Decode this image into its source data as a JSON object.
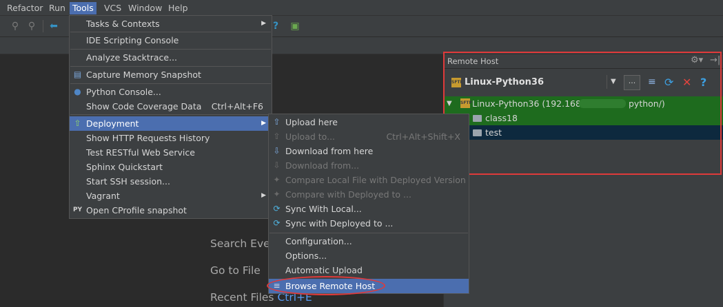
{
  "menubar": {
    "items": [
      "Refactor",
      "Run",
      "Tools",
      "VCS",
      "Window",
      "Help"
    ],
    "active": "Tools"
  },
  "tools_menu": {
    "items": [
      {
        "label": "Tasks & Contexts",
        "submenu": true
      },
      {
        "label": "IDE Scripting Console"
      },
      {
        "label": "Analyze Stacktrace..."
      },
      {
        "label": "Capture Memory Snapshot",
        "icon": "memory-icon"
      },
      {
        "label": "Python Console...",
        "icon": "python-icon"
      },
      {
        "label": "Show Code Coverage Data",
        "shortcut": "Ctrl+Alt+F6"
      },
      {
        "label": "Deployment",
        "submenu": true,
        "highlighted": true,
        "icon": "deployment-icon"
      },
      {
        "label": "Show HTTP Requests History"
      },
      {
        "label": "Test RESTful Web Service"
      },
      {
        "label": "Sphinx Quickstart"
      },
      {
        "label": "Start SSH session..."
      },
      {
        "label": "Vagrant",
        "submenu": true
      },
      {
        "label": "Open CProfile snapshot",
        "icon": "py-icon"
      }
    ]
  },
  "deployment_menu": {
    "items": [
      {
        "label": "Upload here",
        "icon": "upload-icon"
      },
      {
        "label": "Upload to...",
        "shortcut": "Ctrl+Alt+Shift+X",
        "disabled": true,
        "icon": "upload-icon"
      },
      {
        "label": "Download from here",
        "icon": "download-icon"
      },
      {
        "label": "Download from...",
        "disabled": true,
        "icon": "download-icon"
      },
      {
        "label": "Compare Local File with Deployed Version",
        "disabled": true,
        "icon": "compare-icon"
      },
      {
        "label": "Compare with Deployed to ...",
        "disabled": true,
        "icon": "compare-icon"
      },
      {
        "label": "Sync With Local...",
        "icon": "sync-icon"
      },
      {
        "label": "Sync with Deployed to ...",
        "icon": "sync-icon"
      },
      {
        "label": "Configuration..."
      },
      {
        "label": "Options..."
      },
      {
        "label": "Automatic Upload"
      },
      {
        "label": "Browse Remote Host",
        "highlighted": true,
        "icon": "list-icon"
      }
    ]
  },
  "welcome": {
    "search_everywhere": "Search Ever",
    "go_to_file": "Go to File",
    "recent_files": "Recent Files",
    "recent_files_key": "Ctrl+E"
  },
  "remote_host": {
    "title": "Remote Host",
    "server": "Linux-Python36",
    "tree": {
      "root_prefix": "Linux-Python36 (192.168.",
      "root_suffix": "python/)",
      "children": [
        "class18",
        "test"
      ]
    },
    "server_badge": "SFTP"
  },
  "colors": {
    "accent": "#4b6eaf",
    "highlight_box": "#e03a3a",
    "tree_green": "#1e6b1e",
    "tree_selected": "#0d293e"
  }
}
